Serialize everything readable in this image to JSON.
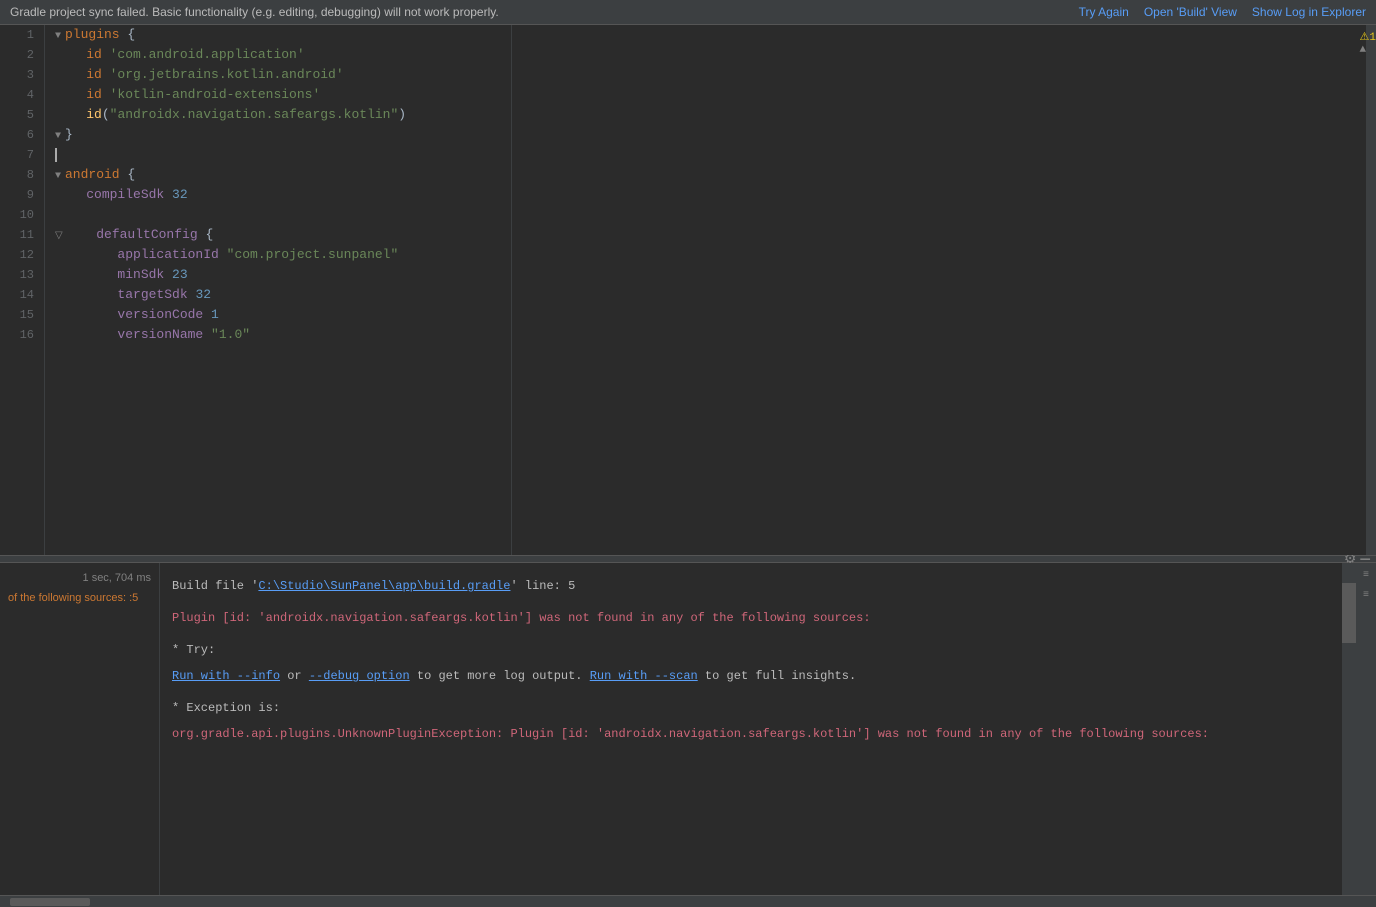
{
  "notification": {
    "message": "Gradle project sync failed. Basic functionality (e.g. editing, debugging) will not work properly.",
    "try_again": "Try Again",
    "open_build": "Open 'Build' View",
    "show_log": "Show Log in Explorer"
  },
  "editor": {
    "lines": [
      {
        "num": 1,
        "tokens": [
          {
            "t": "fold",
            "v": "▼"
          },
          {
            "t": "kw",
            "v": "plugins "
          },
          {
            "t": "plain",
            "v": "{"
          }
        ]
      },
      {
        "num": 2,
        "tokens": [
          {
            "t": "plain",
            "v": "    "
          },
          {
            "t": "kw",
            "v": "id "
          },
          {
            "t": "str",
            "v": "'com.android.application'"
          }
        ]
      },
      {
        "num": 3,
        "tokens": [
          {
            "t": "plain",
            "v": "    "
          },
          {
            "t": "kw",
            "v": "id "
          },
          {
            "t": "str",
            "v": "'org.jetbrains.kotlin.android'"
          }
        ]
      },
      {
        "num": 4,
        "tokens": [
          {
            "t": "plain",
            "v": "    "
          },
          {
            "t": "kw",
            "v": "id "
          },
          {
            "t": "str",
            "v": "'kotlin-android-extensions'"
          }
        ]
      },
      {
        "num": 5,
        "tokens": [
          {
            "t": "plain",
            "v": "    "
          },
          {
            "t": "fn",
            "v": "id"
          },
          {
            "t": "plain",
            "v": "("
          },
          {
            "t": "str",
            "v": "\"androidx.navigation.safeargs.kotlin\""
          },
          {
            "t": "plain",
            "v": ")"
          }
        ]
      },
      {
        "num": 6,
        "tokens": [
          {
            "t": "fold",
            "v": "▼"
          },
          {
            "t": "plain",
            "v": "}"
          }
        ]
      },
      {
        "num": 7,
        "tokens": [
          {
            "t": "cursor",
            "v": ""
          }
        ]
      },
      {
        "num": 8,
        "tokens": [
          {
            "t": "fold",
            "v": "▼"
          },
          {
            "t": "kw",
            "v": "android "
          },
          {
            "t": "plain",
            "v": "{"
          }
        ]
      },
      {
        "num": 9,
        "tokens": [
          {
            "t": "plain",
            "v": "    "
          },
          {
            "t": "prop",
            "v": "compileSdk "
          },
          {
            "t": "num",
            "v": "32"
          }
        ]
      },
      {
        "num": 10,
        "tokens": []
      },
      {
        "num": 11,
        "tokens": [
          {
            "t": "fold",
            "v": "▽"
          },
          {
            "t": "plain",
            "v": "    "
          },
          {
            "t": "prop",
            "v": "defaultConfig "
          },
          {
            "t": "plain",
            "v": "{"
          }
        ]
      },
      {
        "num": 12,
        "tokens": [
          {
            "t": "plain",
            "v": "        "
          },
          {
            "t": "prop",
            "v": "applicationId "
          },
          {
            "t": "str",
            "v": "\"com.project.sunpanel\""
          }
        ]
      },
      {
        "num": 13,
        "tokens": [
          {
            "t": "plain",
            "v": "        "
          },
          {
            "t": "prop",
            "v": "minSdk "
          },
          {
            "t": "num",
            "v": "23"
          }
        ]
      },
      {
        "num": 14,
        "tokens": [
          {
            "t": "plain",
            "v": "        "
          },
          {
            "t": "prop",
            "v": "targetSdk "
          },
          {
            "t": "num",
            "v": "32"
          }
        ]
      },
      {
        "num": 15,
        "tokens": [
          {
            "t": "plain",
            "v": "        "
          },
          {
            "t": "prop",
            "v": "versionCode "
          },
          {
            "t": "num",
            "v": "1"
          }
        ]
      },
      {
        "num": 16,
        "tokens": [
          {
            "t": "plain",
            "v": "        "
          },
          {
            "t": "prop",
            "v": "versionName "
          },
          {
            "t": "str",
            "v": "\"1.0\""
          }
        ]
      }
    ]
  },
  "build_panel": {
    "time": "1 sec, 704 ms",
    "partial_label": "of the following sources: :5",
    "lines": [
      {
        "type": "spacer"
      },
      {
        "type": "error",
        "parts": [
          {
            "t": "white",
            "v": "Build file '"
          },
          {
            "t": "link",
            "v": "C:\\Studio\\SunPanel\\app\\build.gradle"
          },
          {
            "t": "white",
            "v": "' line: 5"
          }
        ]
      },
      {
        "type": "spacer"
      },
      {
        "type": "spacer"
      },
      {
        "type": "error",
        "parts": [
          {
            "t": "error",
            "v": "Plugin [id: 'androidx.navigation.safeargs.kotlin'] was not found in any of the following sources:"
          }
        ]
      },
      {
        "type": "spacer"
      },
      {
        "type": "spacer"
      },
      {
        "type": "normal",
        "parts": [
          {
            "t": "white",
            "v": "* Try:"
          }
        ]
      },
      {
        "type": "spacer"
      },
      {
        "type": "normal",
        "parts": [
          {
            "t": "link",
            "v": "Run with --info"
          },
          {
            "t": "white",
            "v": " or "
          },
          {
            "t": "link",
            "v": "--debug option"
          },
          {
            "t": "white",
            "v": " to get more log output. "
          },
          {
            "t": "link",
            "v": "Run with --scan"
          },
          {
            "t": "white",
            "v": " to get full insights."
          }
        ]
      },
      {
        "type": "spacer"
      },
      {
        "type": "spacer"
      },
      {
        "type": "normal",
        "parts": [
          {
            "t": "white",
            "v": "* Exception is:"
          }
        ]
      },
      {
        "type": "spacer"
      },
      {
        "type": "error",
        "parts": [
          {
            "t": "error",
            "v": "org.gradle.api.plugins.UnknownPluginException: Plugin [id: 'androidx.navigation.safeargs.kotlin'] was not found in any of the following sources:"
          }
        ]
      }
    ]
  },
  "warning_badge": "⚠1",
  "icons": {
    "gear": "⚙",
    "minus": "—",
    "chevron_up": "▲",
    "chevron_down": "▼"
  }
}
